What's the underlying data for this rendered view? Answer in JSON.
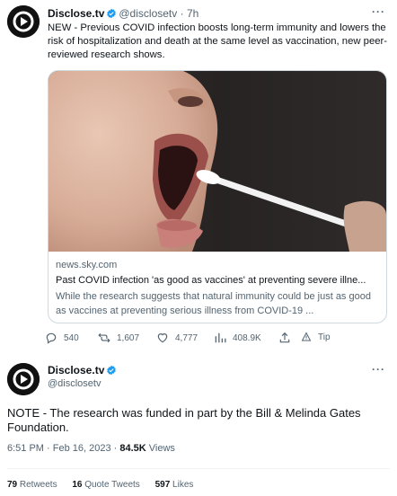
{
  "tweet1": {
    "name": "Disclose.tv",
    "handle": "@disclosetv",
    "separator": "·",
    "time": "7h",
    "more": "···",
    "text": "NEW - Previous COVID infection boosts long-term immunity and lowers the risk of hospitalization and death at the same level as vaccination, new peer-reviewed research shows.",
    "card": {
      "domain": "news.sky.com",
      "title": "Past COVID infection 'as good as vaccines' at preventing severe illne...",
      "description": "While the research suggests that natural immunity could be just as good as vaccines at preventing serious illness from COVID-19 ..."
    },
    "actions": {
      "replies": "540",
      "retweets": "1,607",
      "likes": "4,777",
      "views": "408.9K",
      "tip": "Tip"
    }
  },
  "tweet2": {
    "name": "Disclose.tv",
    "handle": "@disclosetv",
    "more": "···",
    "text": "NOTE - The research was funded in part by the Bill & Melinda Gates Foundation.",
    "timestamp": "6:51 PM · Feb 16, 2023 · ",
    "views_count": "84.5K",
    "views_label": " Views",
    "stats": {
      "retweets_count": "79",
      "retweets_label": " Retweets",
      "quotes_count": "16",
      "quotes_label": " Quote Tweets",
      "likes_count": "597",
      "likes_label": " Likes"
    }
  },
  "colors": {
    "text": "#0f1419",
    "secondary": "#536471",
    "verified": "#1d9bf0",
    "border": "#cfd9de"
  }
}
